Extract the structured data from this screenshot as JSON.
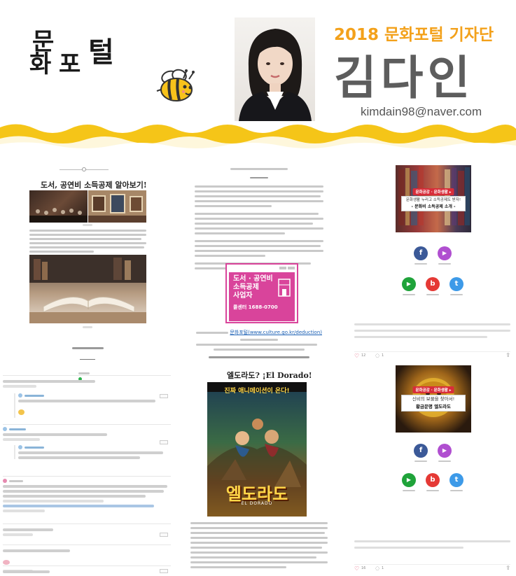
{
  "banner": {
    "logo_chars": [
      "문",
      "화",
      "포",
      "털"
    ],
    "header_line": "2018 문화포털 기자단",
    "name": "김다인",
    "email": "kimdain98@naver.com"
  },
  "article1": {
    "title": "도서, 공연비 소득공제 알아보기!"
  },
  "article2": {
    "title": "엘도라도? ¡El Dorado!",
    "poster_tagline": "진짜 애니메이션이 온다!",
    "poster_title": "엘도라도",
    "poster_subtitle": "EL DORADO",
    "ad_sign": {
      "line1": "도서 · 공연비",
      "line2": "소득공제",
      "line3": "사업자",
      "phone": "콜센터 1688-0700"
    },
    "link_text": "문화포털(www.culture.go.kr/deduction)"
  },
  "card1": {
    "badge": "문화공감 · 문화생활 ▸",
    "caption_line1": "문화생활 누리고 소득공제도 받자!",
    "caption_line2": "- 문화비 소득공제 소개 -",
    "likes": "12",
    "comments": "1"
  },
  "card2": {
    "badge": "문화공감 · 문화생활 ▸",
    "caption_line1": "신비의 보물을 찾아서!",
    "caption_line2": "황금문명 엘도라도",
    "likes": "16",
    "comments": "1"
  },
  "share": {
    "facebook": "f",
    "instagram": "▶",
    "tv": "▶",
    "blog": "b",
    "twitter": "t"
  },
  "colors": {
    "accent_yellow": "#f5c518",
    "header_orange": "#f3a11b",
    "name_gray": "#5d5d5d",
    "sign_pink": "#d9449b",
    "facebook_blue": "#3b5998",
    "instagram_purple": "#b04fd0",
    "tv_green": "#1fa33a",
    "blog_red": "#e53935",
    "twitter_blue": "#3d9ae8"
  }
}
